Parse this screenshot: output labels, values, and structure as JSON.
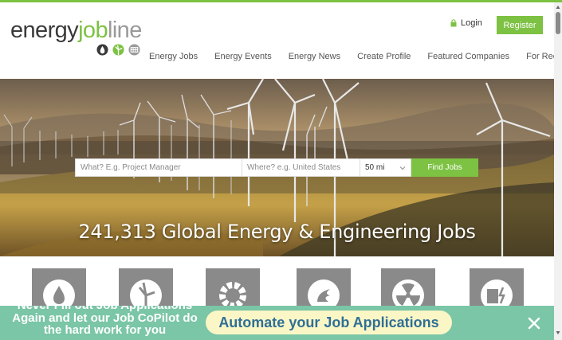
{
  "brand": {
    "logo_parts": [
      "energy",
      "job",
      "line"
    ],
    "accent_color": "#7dc243",
    "banner_color": "#7ac6a6",
    "icon_names": [
      "oil-drop-icon",
      "wind-turbine-icon",
      "solar-panel-icon"
    ]
  },
  "header": {
    "login_label": "Login",
    "register_label": "Register"
  },
  "nav": {
    "items": [
      "Energy Jobs",
      "Energy Events",
      "Energy News",
      "Create Profile",
      "Featured Companies",
      "For Recruiters"
    ]
  },
  "search": {
    "what_placeholder": "What? E.g. Project Manager",
    "where_placeholder": "Where? e.g. United States",
    "radius_value": "50 mi",
    "find_label": "Find Jobs"
  },
  "hero": {
    "headline": "241,313 Global Energy & Engineering Jobs"
  },
  "categories": {
    "icons": [
      "oil-gas-icon",
      "renewables-icon",
      "engineering-gear-icon",
      "fossil-flame-icon",
      "nuclear-icon",
      "power-utilities-icon"
    ]
  },
  "banner": {
    "message": "Never Fill out Job Applications Again and let our Job CoPilot do the hard work for you",
    "cta_label": "Automate your Job Applications"
  }
}
